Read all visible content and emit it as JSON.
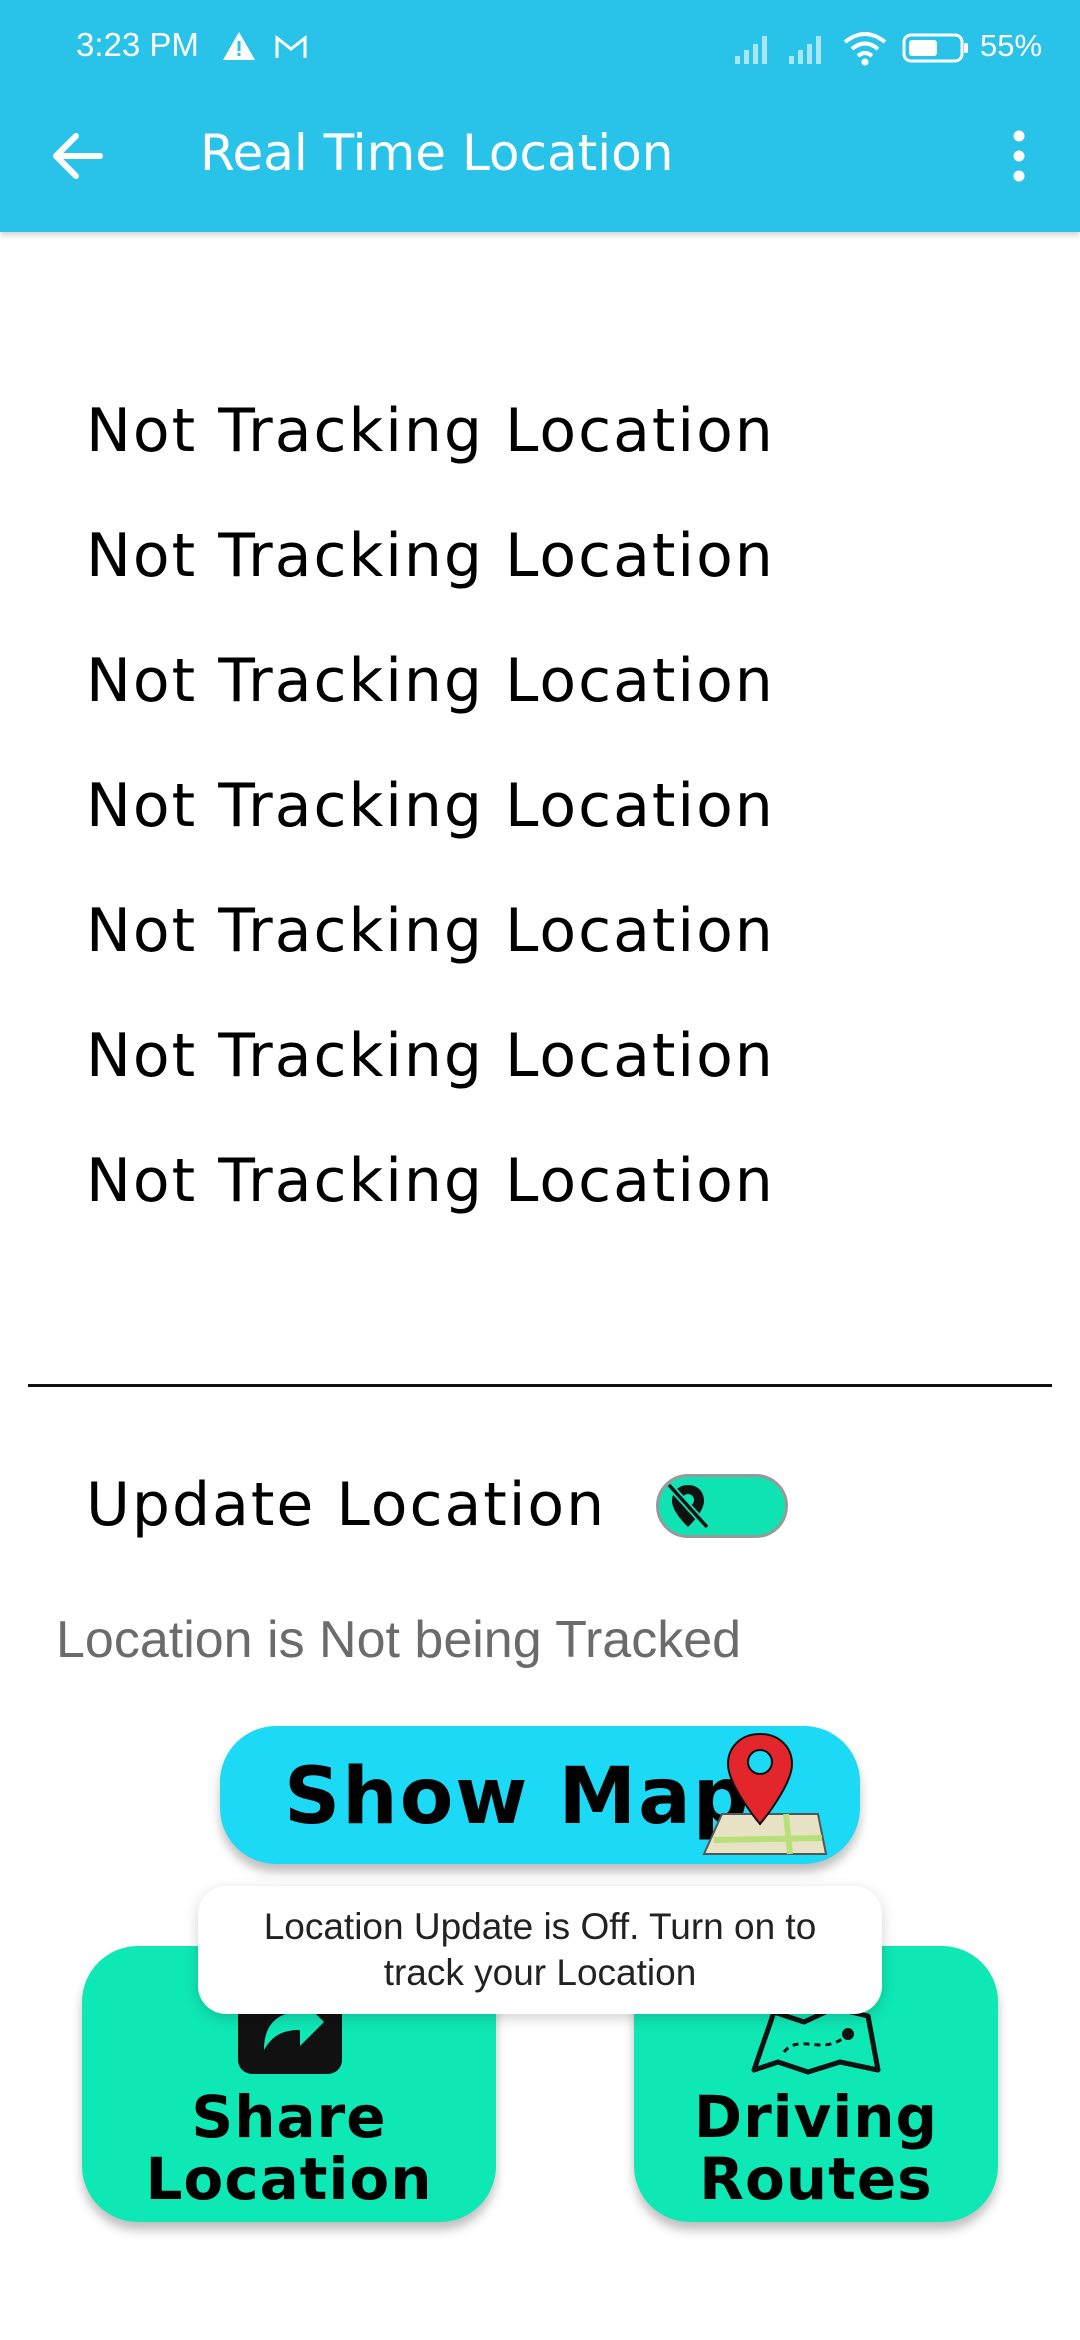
{
  "status_bar": {
    "time": "3:23 PM",
    "battery": "55%"
  },
  "app_bar": {
    "title": "Real Time Location"
  },
  "status_lines": [
    "Not Tracking Location",
    "Not Tracking Location",
    "Not Tracking Location",
    "Not Tracking Location",
    "Not Tracking Location",
    "Not Tracking Location",
    "Not Tracking Location"
  ],
  "update_location": {
    "label": "Update Location",
    "toggle_on": false
  },
  "tracking_status": "Location is Not being Tracked",
  "show_map": {
    "label": "Show Map"
  },
  "tiles": {
    "share": [
      "Share",
      "Location"
    ],
    "routes": [
      "Driving",
      "Routes"
    ]
  },
  "toast": {
    "line1": "Location Update is Off. Turn on to",
    "line2": "track your Location"
  },
  "colors": {
    "app_bar": "#29c2e8",
    "toggle": "#10e3b3",
    "show_map": "#1cd9f5",
    "tiles": "#0ee8b5"
  }
}
